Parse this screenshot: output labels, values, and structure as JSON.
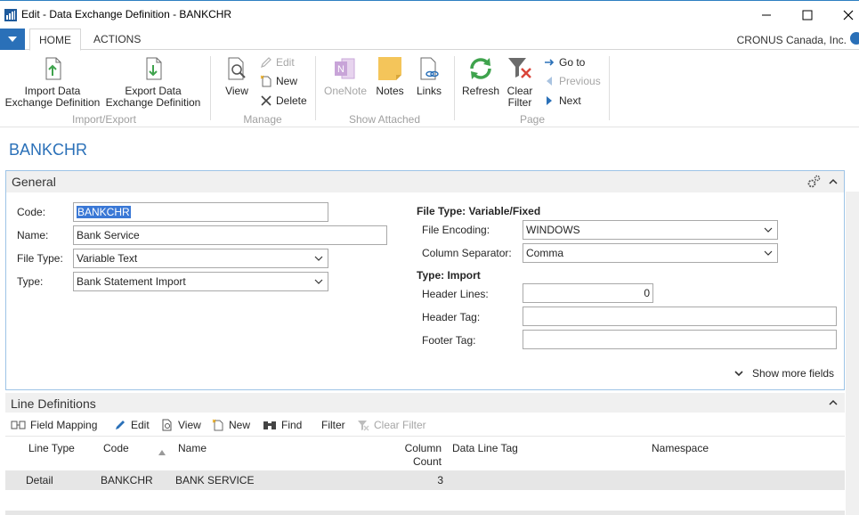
{
  "window": {
    "title": "Edit - Data Exchange Definition - BANKCHR",
    "company": "CRONUS Canada, Inc."
  },
  "ribbon": {
    "tabs": [
      "HOME",
      "ACTIONS"
    ],
    "groups": {
      "import_export": {
        "caption": "Import/Export",
        "import_l1": "Import Data",
        "import_l2": "Exchange Definition",
        "export_l1": "Export Data",
        "export_l2": "Exchange Definition"
      },
      "manage": {
        "caption": "Manage",
        "view": "View",
        "edit": "Edit",
        "new": "New",
        "delete": "Delete"
      },
      "show_attached": {
        "caption": "Show Attached",
        "onenote": "OneNote",
        "notes": "Notes",
        "links": "Links"
      },
      "page": {
        "caption": "Page",
        "refresh": "Refresh",
        "clear_filter_l1": "Clear",
        "clear_filter_l2": "Filter",
        "goto": "Go to",
        "previous": "Previous",
        "next": "Next"
      }
    }
  },
  "page_title": "BANKCHR",
  "general": {
    "header": "General",
    "code_label": "Code:",
    "code_value": "BANKCHR",
    "name_label": "Name:",
    "name_value": "Bank Service",
    "file_type_label": "File Type:",
    "file_type_value": "Variable Text",
    "type_label": "Type:",
    "type_value": "Bank Statement Import",
    "group_file_type": "File Type: Variable/Fixed",
    "file_encoding_label": "File Encoding:",
    "file_encoding_value": "WINDOWS",
    "column_separator_label": "Column Separator:",
    "column_separator_value": "Comma",
    "group_type": "Type: Import",
    "header_lines_label": "Header Lines:",
    "header_lines_value": "0",
    "header_tag_label": "Header Tag:",
    "header_tag_value": "",
    "footer_tag_label": "Footer Tag:",
    "footer_tag_value": "",
    "show_more": "Show more fields"
  },
  "line_definitions": {
    "header": "Line Definitions",
    "actions": {
      "field_mapping": "Field Mapping",
      "edit": "Edit",
      "view": "View",
      "new": "New",
      "find": "Find",
      "filter": "Filter",
      "clear_filter": "Clear Filter"
    },
    "columns": {
      "line_type": "Line Type",
      "code": "Code",
      "name": "Name",
      "column_count_l1": "Column",
      "column_count_l2": "Count",
      "data_line_tag": "Data Line Tag",
      "namespace": "Namespace"
    },
    "rows": [
      {
        "line_type": "Detail",
        "code": "BANKCHR",
        "name": "BANK SERVICE",
        "column_count": "3",
        "data_line_tag": "",
        "namespace": ""
      }
    ]
  },
  "colors": {
    "accent": "#2a70b8",
    "selection": "#3a78d6",
    "panel_border": "#9dc3e6"
  }
}
